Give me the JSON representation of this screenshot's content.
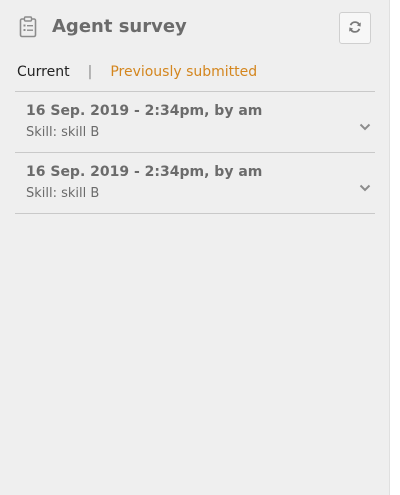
{
  "header": {
    "icon": "clipboard-icon",
    "title": "Agent survey",
    "refresh_icon": "refresh-icon"
  },
  "tabs": {
    "current": "Current",
    "separator": "|",
    "previous": "Previously submitted",
    "previous_color": "#d4861e"
  },
  "surveys": [
    {
      "title": "16 Sep. 2019 - 2:34pm, by am",
      "subtitle": "Skill: skill B",
      "icon": "chevron-down-icon"
    },
    {
      "title": "16 Sep. 2019 - 2:34pm, by am",
      "subtitle": "Skill: skill B",
      "icon": "chevron-down-icon"
    }
  ]
}
